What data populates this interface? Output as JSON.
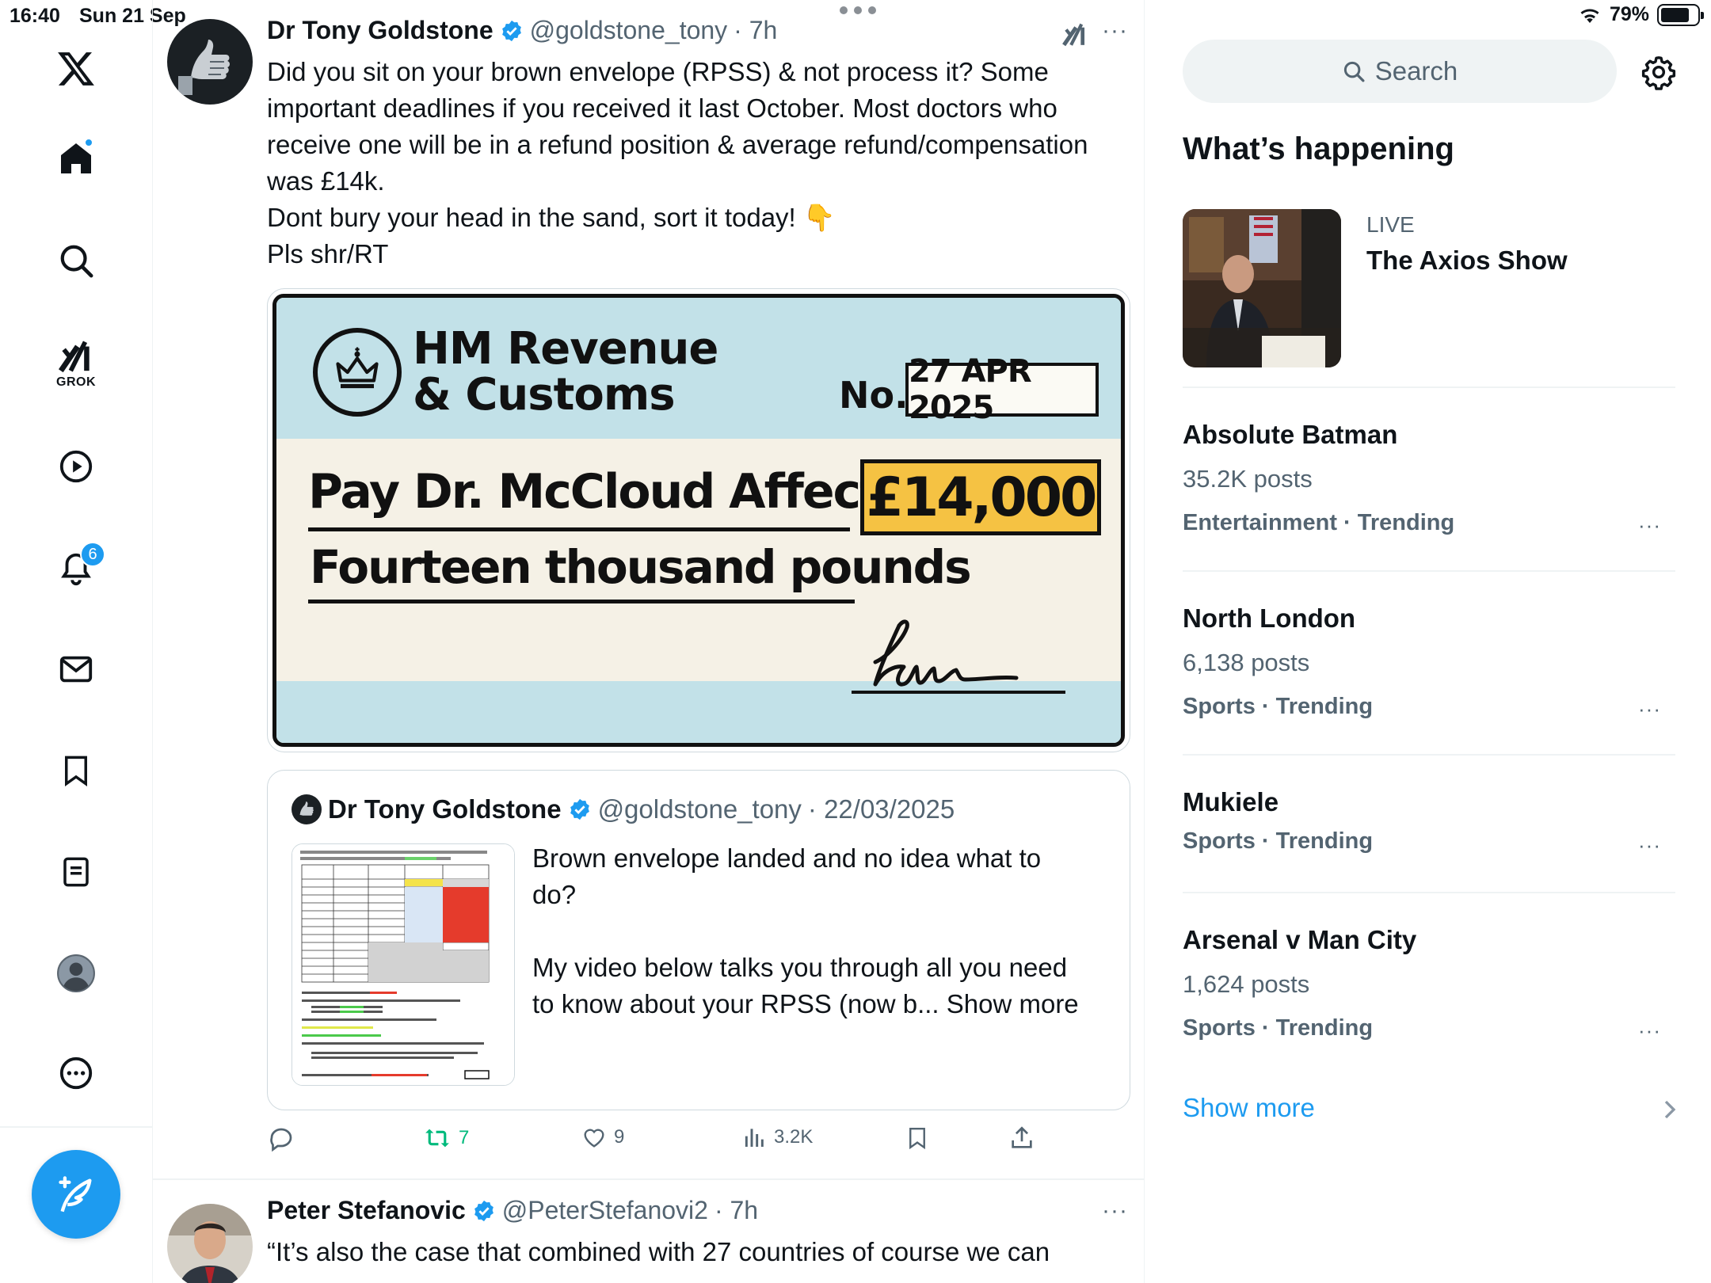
{
  "status_bar": {
    "time": "16:40",
    "date": "Sun 21 Sep",
    "battery": "79%",
    "battery_level": 0.79
  },
  "nav": {
    "grok_label": "GROK",
    "notifications_badge": "6"
  },
  "tweet": {
    "author_name": "Dr Tony Goldstone",
    "author_handle": "@goldstone_tony",
    "time": "· 7h",
    "more": "···",
    "text_lines": [
      "Did you sit on your brown envelope (RPSS) & not process it? Some",
      "important deadlines if you received it last October. Most doctors who",
      "receive one will be in a refund position & average refund/compensation",
      "was £14k.",
      "Dont bury your head in the sand, sort it today! 👇",
      "Pls shr/RT"
    ],
    "cheque": {
      "issuer_line1": "HM Revenue",
      "issuer_line2": "& Customs",
      "no_label": "No.",
      "date": "27 APR 2025",
      "payee": "Pay Dr. McCloud Affected",
      "amount": "£14,000",
      "amount_words": "Fourteen thousand pounds",
      "bg_color": "#c2e1e8",
      "amount_color": "#f5c243"
    },
    "quote": {
      "author_name": "Dr Tony Goldstone",
      "author_handle": "@goldstone_tony",
      "date": "· 22/03/2025",
      "text_line1": "Brown envelope landed and no idea what to",
      "text_line2": "do?",
      "text_line3": "My video below talks you through all you need",
      "text_line4": "to know about your RPSS (now b... Show more"
    },
    "actions": {
      "retweets": "7",
      "likes": "9",
      "views": "3.2K"
    }
  },
  "next_tweet": {
    "author_name": "Peter Stefanovic",
    "author_handle": "@PeterStefanovi2",
    "time": "· 7h",
    "text": "“It’s also the case that combined with 27 countries of course we can"
  },
  "sidebar": {
    "search_placeholder": "Search",
    "whats_happening": "What’s happening",
    "live": {
      "label": "LIVE",
      "title": "The Axios Show"
    },
    "trends": [
      {
        "name": "Absolute Batman",
        "count": "35.2K posts",
        "meta": "Entertainment · Trending"
      },
      {
        "name": "North London",
        "count": "6,138 posts",
        "meta": "Sports · Trending"
      },
      {
        "name": "Mukiele",
        "count": "",
        "meta": "Sports · Trending"
      },
      {
        "name": "Arsenal v Man City",
        "count": "1,624 posts",
        "meta": "Sports · Trending"
      }
    ],
    "show_more": "Show more"
  },
  "colors": {
    "accent": "#1d9bf0",
    "retweet": "#00ba7c",
    "muted": "#536471"
  }
}
